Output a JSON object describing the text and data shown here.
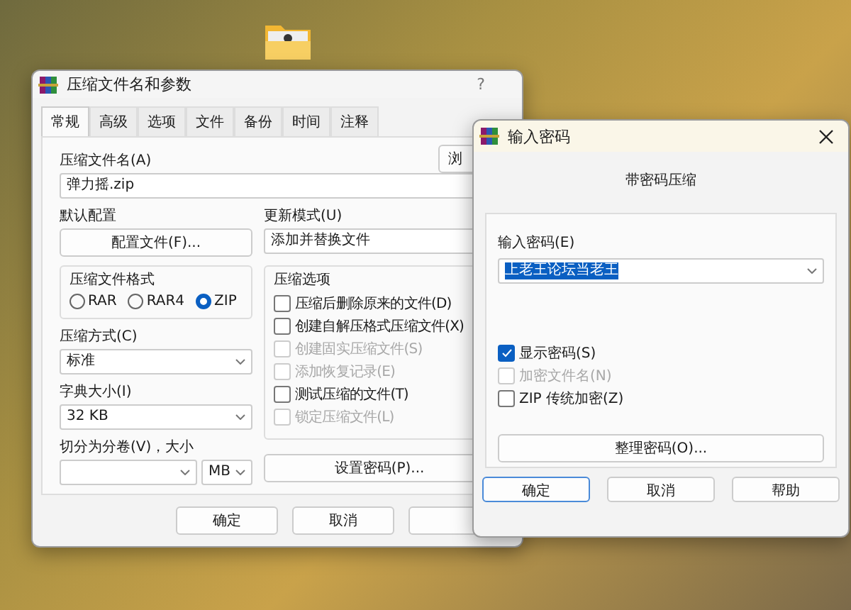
{
  "main_dialog": {
    "title": "压缩文件名和参数",
    "help": "?",
    "tabs": [
      {
        "label": "常规",
        "selected": true
      },
      {
        "label": "高级",
        "selected": false
      },
      {
        "label": "选项",
        "selected": false
      },
      {
        "label": "文件",
        "selected": false
      },
      {
        "label": "备份",
        "selected": false
      },
      {
        "label": "时间",
        "selected": false
      },
      {
        "label": "注释",
        "selected": false
      }
    ],
    "archive_name_label": "压缩文件名(A)",
    "browse_button": "浏",
    "archive_name": "弹力摇.zip",
    "profile_label": "默认配置",
    "profile_button": "配置文件(F)...",
    "update_mode_label": "更新模式(U)",
    "update_mode": "添加并替换文件",
    "format_group": {
      "title": "压缩文件格式",
      "options": [
        {
          "label": "RAR",
          "selected": false
        },
        {
          "label": "RAR4",
          "selected": false
        },
        {
          "label": "ZIP",
          "selected": true
        }
      ]
    },
    "method_label": "压缩方式(C)",
    "method": "标准",
    "dictionary_label": "字典大小(I)",
    "dictionary": "32 KB",
    "split_label": "切分为分卷(V)，大小",
    "split_unit": "MB",
    "options_group": {
      "title": "压缩选项",
      "items": [
        {
          "label": "压缩后删除原来的文件(D)",
          "checked": false,
          "disabled": false
        },
        {
          "label": "创建自解压格式压缩文件(X)",
          "checked": false,
          "disabled": false
        },
        {
          "label": "创建固实压缩文件(S)",
          "checked": false,
          "disabled": true
        },
        {
          "label": "添加恢复记录(E)",
          "checked": false,
          "disabled": true
        },
        {
          "label": "测试压缩的文件(T)",
          "checked": false,
          "disabled": false
        },
        {
          "label": "锁定压缩文件(L)",
          "checked": false,
          "disabled": true
        }
      ]
    },
    "password_button": "设置密码(P)...",
    "buttons": [
      "确定",
      "取消"
    ]
  },
  "password_dialog": {
    "title": "输入密码",
    "heading": "带密码压缩",
    "password_label": "输入密码(E)",
    "password": "上老王论坛当老王",
    "password_text_selected": true,
    "checkboxes": [
      {
        "label": "显示密码(S)",
        "checked": true,
        "disabled": false
      },
      {
        "label": "加密文件名(N)",
        "checked": false,
        "disabled": true
      },
      {
        "label": "ZIP 传统加密(Z)",
        "checked": false,
        "disabled": false
      }
    ],
    "organize_button": "整理密码(O)...",
    "buttons": [
      {
        "label": "确定",
        "default": true
      },
      {
        "label": "取消",
        "default": false
      },
      {
        "label": "帮助",
        "default": false
      }
    ]
  }
}
